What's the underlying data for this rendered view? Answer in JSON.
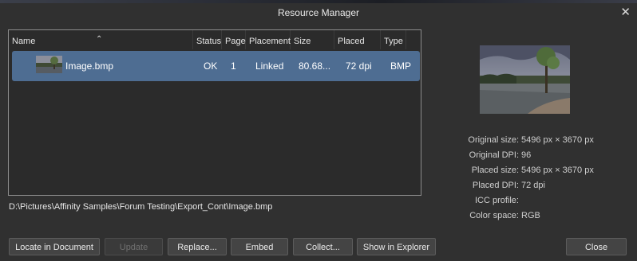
{
  "window": {
    "title": "Resource Manager",
    "close_glyph": "✕"
  },
  "columns": [
    "Name",
    "Status",
    "Page",
    "Placement",
    "Size",
    "Placed DPI",
    "Type"
  ],
  "resources": [
    {
      "name": "Image.bmp",
      "status": "OK",
      "page": "1",
      "placement": "Linked",
      "size": "80.68...",
      "placed_dpi": "72 dpi",
      "type": "BMP"
    }
  ],
  "path": "D:\\Pictures\\Affinity Samples\\Forum Testing\\Export_Cont\\Image.bmp",
  "info": {
    "original_size_label": "Original size:",
    "original_size": "5496 px × 3670 px",
    "original_dpi_label": "Original DPI:",
    "original_dpi": "96",
    "placed_size_label": "Placed size:",
    "placed_size": "5496 px × 3670 px",
    "placed_dpi_label": "Placed DPI:",
    "placed_dpi": "72 dpi",
    "icc_label": "ICC profile:",
    "icc": "",
    "color_space_label": "Color space:",
    "color_space": "RGB"
  },
  "buttons": {
    "locate": "Locate in Document",
    "update": "Update",
    "replace": "Replace...",
    "embed": "Embed",
    "collect": "Collect...",
    "show": "Show in Explorer",
    "close": "Close"
  },
  "colors": {
    "background": "#303030",
    "selection": "#4e6d92",
    "list_border": "#8c8c8c"
  }
}
